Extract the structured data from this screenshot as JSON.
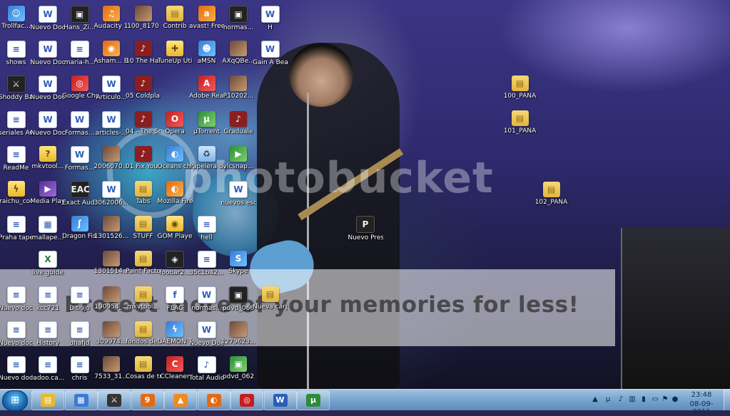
{
  "desktop": {
    "watermark": {
      "logo": "photobucket",
      "tagline": "Protect more of your memories for less!"
    },
    "icons": [
      {
        "label": "Trollfac...",
        "kind": "app",
        "glyph": "☺",
        "col": 0,
        "row": 0
      },
      {
        "label": "Nuevo Docum...",
        "kind": "word",
        "glyph": "W",
        "col": 1,
        "row": 0
      },
      {
        "label": "Hans_Zi...",
        "kind": "dark",
        "glyph": "▣",
        "col": 2,
        "row": 0
      },
      {
        "label": "Audacity 1.3 Beta...",
        "kind": "orange",
        "glyph": "♫",
        "col": 3,
        "row": 0
      },
      {
        "label": "100_8170",
        "kind": "photo",
        "glyph": "",
        "col": 4,
        "row": 0
      },
      {
        "label": "Contrib",
        "kind": "folder",
        "glyph": "▤",
        "col": 5,
        "row": 0
      },
      {
        "label": "avast! Free Antivirus",
        "kind": "orange",
        "glyph": "a",
        "col": 6,
        "row": 0
      },
      {
        "label": "normas...",
        "kind": "dark",
        "glyph": "▣",
        "col": 7,
        "row": 0
      },
      {
        "label": "H",
        "kind": "word",
        "glyph": "W",
        "col": 8,
        "row": 0
      },
      {
        "label": "shows",
        "kind": "doc",
        "glyph": "≡",
        "col": 0,
        "row": 1
      },
      {
        "label": "Nuevo Docum...",
        "kind": "word",
        "glyph": "W",
        "col": 1,
        "row": 1
      },
      {
        "label": "maria-h...",
        "kind": "doc",
        "glyph": "≡",
        "col": 2,
        "row": 1
      },
      {
        "label": "Asham... Burning...",
        "kind": "orange",
        "glyph": "◉",
        "col": 3,
        "row": 1
      },
      {
        "label": "10 The Harde...",
        "kind": "media",
        "glyph": "♪",
        "col": 4,
        "row": 1
      },
      {
        "label": "TuneUp Utilities",
        "kind": "yellow",
        "glyph": "✚",
        "col": 5,
        "row": 1
      },
      {
        "label": "aMSN",
        "kind": "app",
        "glyph": "☻",
        "col": 6,
        "row": 1
      },
      {
        "label": "AXqQBe...",
        "kind": "photo",
        "glyph": "",
        "col": 7,
        "row": 1
      },
      {
        "label": "Gain A Beautif...",
        "kind": "word",
        "glyph": "W",
        "col": 8,
        "row": 1
      },
      {
        "label": "Shoddy Battle",
        "kind": "dark",
        "glyph": "⚔",
        "col": 0,
        "row": 2
      },
      {
        "label": "Nuevo Docum...",
        "kind": "word",
        "glyph": "W",
        "col": 1,
        "row": 2
      },
      {
        "label": "Google Chrome",
        "kind": "red",
        "glyph": "◎",
        "col": 2,
        "row": 2
      },
      {
        "label": "Articulo...",
        "kind": "word",
        "glyph": "W",
        "col": 3,
        "row": 2
      },
      {
        "label": "05 Coldpla...",
        "kind": "media",
        "glyph": "♪",
        "col": 4,
        "row": 2
      },
      {
        "label": "Adobe Reader 9",
        "kind": "red",
        "glyph": "A",
        "col": 6,
        "row": 2
      },
      {
        "label": "P10202...",
        "kind": "photo",
        "glyph": "",
        "col": 7,
        "row": 2
      },
      {
        "label": "seriales Avast",
        "kind": "doc",
        "glyph": "≡",
        "col": 0,
        "row": 3
      },
      {
        "label": "Nuevo Docum...",
        "kind": "word",
        "glyph": "W",
        "col": 1,
        "row": 3
      },
      {
        "label": "Formas...",
        "kind": "word",
        "glyph": "W",
        "col": 2,
        "row": 3
      },
      {
        "label": "articles-...",
        "kind": "word",
        "glyph": "W",
        "col": 3,
        "row": 3
      },
      {
        "label": "04 - The Scientist",
        "kind": "media",
        "glyph": "♪",
        "col": 4,
        "row": 3
      },
      {
        "label": "Opera",
        "kind": "red",
        "glyph": "O",
        "col": 5,
        "row": 3
      },
      {
        "label": "µTorrent",
        "kind": "green",
        "glyph": "µ",
        "col": 6,
        "row": 3
      },
      {
        "label": "Graduale",
        "kind": "media",
        "glyph": "♪",
        "col": 7,
        "row": 3
      },
      {
        "label": "ReadMe",
        "kind": "doc",
        "glyph": "≡",
        "col": 0,
        "row": 4
      },
      {
        "label": "mkvtool...",
        "kind": "yellow",
        "glyph": "?",
        "col": 1,
        "row": 4
      },
      {
        "label": "Formas...",
        "kind": "word",
        "glyph": "W",
        "col": 2,
        "row": 4
      },
      {
        "label": "2006070... Discurso...",
        "kind": "photo",
        "glyph": "",
        "col": 3,
        "row": 4
      },
      {
        "label": "01 Fix You (Edit)",
        "kind": "media",
        "glyph": "♪",
        "col": 4,
        "row": 4
      },
      {
        "label": "Oceans change...",
        "kind": "app",
        "glyph": "◐",
        "col": 5,
        "row": 4
      },
      {
        "label": "Papelera de reci...",
        "kind": "recycle",
        "glyph": "♻",
        "col": 6,
        "row": 4
      },
      {
        "label": "vlcsnap...",
        "kind": "green",
        "glyph": "▶",
        "col": 7,
        "row": 4
      },
      {
        "label": "raichu_cor",
        "kind": "yellow",
        "glyph": "ϟ",
        "col": 0,
        "row": 5
      },
      {
        "label": "Media Player ...",
        "kind": "purple",
        "glyph": "▶",
        "col": 1,
        "row": 5
      },
      {
        "label": "Exact Aud...",
        "kind": "dark",
        "glyph": "EAC",
        "col": 2,
        "row": 5
      },
      {
        "label": "3062006...",
        "kind": "word",
        "glyph": "W",
        "col": 3,
        "row": 5
      },
      {
        "label": "Tabs",
        "kind": "folder",
        "glyph": "▤",
        "col": 4,
        "row": 5
      },
      {
        "label": "Mozilla Firefox",
        "kind": "orange",
        "glyph": "◐",
        "col": 5,
        "row": 5
      },
      {
        "label": "nuevos escritos",
        "kind": "word",
        "glyph": "W",
        "col": 7,
        "row": 5
      },
      {
        "label": "Praha tapers",
        "kind": "doc",
        "glyph": "≡",
        "col": 0,
        "row": 6
      },
      {
        "label": "mallape...",
        "kind": "doc",
        "glyph": "▦",
        "col": 1,
        "row": 6
      },
      {
        "label": "Dragon Fist 3 - A...",
        "kind": "app",
        "glyph": "ʃ",
        "col": 2,
        "row": 6
      },
      {
        "label": "1301526...",
        "kind": "photo",
        "glyph": "",
        "col": 3,
        "row": 6
      },
      {
        "label": "STUFF",
        "kind": "folder",
        "glyph": "▤",
        "col": 4,
        "row": 6
      },
      {
        "label": "GOM Player",
        "kind": "yellow",
        "glyph": "◉",
        "col": 5,
        "row": 6
      },
      {
        "label": "hell",
        "kind": "doc",
        "glyph": "≡",
        "col": 6,
        "row": 6
      },
      {
        "label": "Nuevo Presenta...",
        "kind": "dark",
        "glyph": "P",
        "col": 11,
        "row": 6
      },
      {
        "label": "live guide",
        "kind": "excel",
        "glyph": "X",
        "col": 1,
        "row": 7
      },
      {
        "label": "1301514...",
        "kind": "photo",
        "glyph": "",
        "col": 3,
        "row": 7
      },
      {
        "label": "Paint Factory",
        "kind": "folder",
        "glyph": "▤",
        "col": 4,
        "row": 7
      },
      {
        "label": "foobar2...",
        "kind": "dark",
        "glyph": "◈",
        "col": 5,
        "row": 7
      },
      {
        "label": "35c1b42...",
        "kind": "doc",
        "glyph": "≡",
        "col": 6,
        "row": 7
      },
      {
        "label": "Skype",
        "kind": "app",
        "glyph": "S",
        "col": 7,
        "row": 7
      },
      {
        "label": "Nuevo docume...",
        "kind": "doc",
        "glyph": "≡",
        "col": 0,
        "row": 8
      },
      {
        "label": "kcc721",
        "kind": "doc",
        "glyph": "≡",
        "col": 1,
        "row": 8
      },
      {
        "label": "Dibujo",
        "kind": "doc",
        "glyph": "≡",
        "col": 2,
        "row": 8
      },
      {
        "label": "190954_...",
        "kind": "photo",
        "glyph": "",
        "col": 3,
        "row": 8
      },
      {
        "label": "mkvtool...",
        "kind": "folder",
        "glyph": "▤",
        "col": 4,
        "row": 8
      },
      {
        "label": "FLAC",
        "kind": "doc",
        "glyph": "f",
        "col": 5,
        "row": 8
      },
      {
        "label": "normas...",
        "kind": "word",
        "glyph": "W",
        "col": 6,
        "row": 8
      },
      {
        "label": "pdvd_066",
        "kind": "dark",
        "glyph": "▣",
        "col": 7,
        "row": 8
      },
      {
        "label": "Nueva carpeta",
        "kind": "folder",
        "glyph": "▤",
        "col": 8,
        "row": 8
      },
      {
        "label": "Nuevo docume...",
        "kind": "doc",
        "glyph": "≡",
        "col": 0,
        "row": 9
      },
      {
        "label": "History",
        "kind": "doc",
        "glyph": "≡",
        "col": 1,
        "row": 9
      },
      {
        "label": "dhafjd",
        "kind": "doc",
        "glyph": "≡",
        "col": 2,
        "row": 9
      },
      {
        "label": "309974...",
        "kind": "photo",
        "glyph": "",
        "col": 3,
        "row": 9
      },
      {
        "label": "fondos de escritorio",
        "kind": "folder",
        "glyph": "▤",
        "col": 4,
        "row": 9
      },
      {
        "label": "DAEMON Tools Lite",
        "kind": "app",
        "glyph": "ϟ",
        "col": 5,
        "row": 9
      },
      {
        "label": "Nuevo Docum...",
        "kind": "word",
        "glyph": "W",
        "col": 6,
        "row": 9
      },
      {
        "label": "1279623...",
        "kind": "photo",
        "glyph": "",
        "col": 7,
        "row": 9
      },
      {
        "label": "Nuevo docume...",
        "kind": "doc",
        "glyph": "≡",
        "col": 0,
        "row": 10
      },
      {
        "label": "Iadoo.ca...",
        "kind": "doc",
        "glyph": "≡",
        "col": 1,
        "row": 10
      },
      {
        "label": "chris",
        "kind": "doc",
        "glyph": "≡",
        "col": 2,
        "row": 10
      },
      {
        "label": "7533_31...",
        "kind": "photo",
        "glyph": "",
        "col": 3,
        "row": 10
      },
      {
        "label": "Cosas de trabajo",
        "kind": "folder",
        "glyph": "▤",
        "col": 4,
        "row": 10
      },
      {
        "label": "CCleaner",
        "kind": "red",
        "glyph": "C",
        "col": 5,
        "row": 10
      },
      {
        "label": "Total Audio C...",
        "kind": "doc",
        "glyph": "♪",
        "col": 6,
        "row": 10
      },
      {
        "label": "pdvd_062",
        "kind": "green",
        "glyph": "▣",
        "col": 7,
        "row": 10
      }
    ],
    "right_icons": [
      {
        "label": "100_PANA",
        "kind": "folder",
        "glyph": "▤",
        "slot": 0
      },
      {
        "label": "101_PANA",
        "kind": "folder",
        "glyph": "▤",
        "slot": 1
      },
      {
        "label": "102_PANA",
        "kind": "folder",
        "glyph": "▤",
        "slot": 2
      }
    ]
  },
  "taskbar": {
    "pinned": [
      {
        "name": "explorer",
        "glyph": "▤",
        "color": "#e8b92b"
      },
      {
        "name": "control-panel",
        "glyph": "▦",
        "color": "#3a7bd5"
      },
      {
        "name": "shoddy-battle",
        "glyph": "⚔",
        "color": "#333333"
      },
      {
        "name": "app-9",
        "glyph": "9",
        "color": "#e36a12"
      },
      {
        "name": "vlc",
        "glyph": "▲",
        "color": "#f08a1c"
      },
      {
        "name": "firefox",
        "glyph": "◐",
        "color": "#e36a12"
      },
      {
        "name": "chrome",
        "glyph": "◎",
        "color": "#c51e1e"
      },
      {
        "name": "word",
        "glyph": "W",
        "color": "#2b5db8"
      },
      {
        "name": "utorrent",
        "glyph": "µ",
        "color": "#2e8b3a"
      }
    ],
    "tray": {
      "time": "23:48",
      "date": "08-09-2011"
    }
  }
}
